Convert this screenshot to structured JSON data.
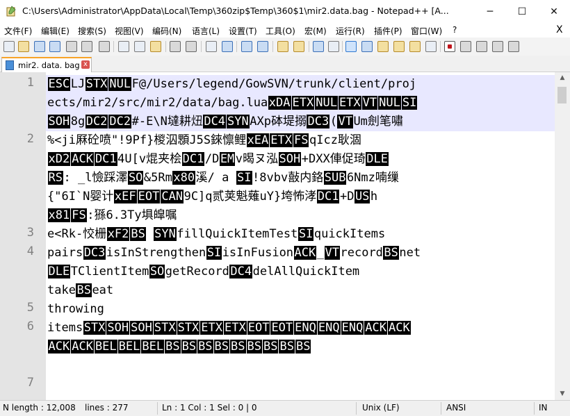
{
  "window": {
    "title": "C:\\Users\\Administrator\\AppData\\Local\\Temp\\360zip$Temp\\360$1\\mir2.data.bag - Notepad++ [A...",
    "minimize": "─",
    "maximize": "☐",
    "close": "✕"
  },
  "menu": {
    "items": [
      "文件(F)",
      "编辑(E)",
      "搜索(S)",
      "视图(V)",
      "编码(N)",
      "语言(L)",
      "设置(T)",
      "工具(O)",
      "宏(M)",
      "运行(R)",
      "插件(P)",
      "窗口(W)",
      "?"
    ],
    "close_doc": "X"
  },
  "tab": {
    "label": "mir2. data. bag",
    "close": "x"
  },
  "editor": {
    "line_numbers": [
      "1",
      "2",
      "3",
      "4",
      "5",
      "6",
      "7"
    ],
    "rows": [
      [
        {
          "c": "ESC"
        },
        {
          "t": "LJ"
        },
        {
          "c": "STX"
        },
        {
          "c": "NUL"
        },
        {
          "t": "F@/Users/legend/GowSVN/trunk/client/proj"
        }
      ],
      [
        {
          "t": "ects/mir2/src/mir2/data/bag.lua"
        },
        {
          "c": "xDA"
        },
        {
          "c": "ETX"
        },
        {
          "c": "NUL"
        },
        {
          "c": "ETX"
        },
        {
          "c": "VT"
        },
        {
          "c": "NUL"
        },
        {
          "c": "SI"
        }
      ],
      [
        {
          "c": "SOH"
        },
        {
          "t": "8g"
        },
        {
          "c": "DC2"
        },
        {
          "c": "DC2"
        },
        {
          "t": "#-E\\N墶耕炄"
        },
        {
          "c": "DC4"
        },
        {
          "c": "SYN"
        },
        {
          "t": "AXp砵堤搦"
        },
        {
          "c": "DC3"
        },
        {
          "t": "("
        },
        {
          "c": "VT"
        },
        {
          "t": "Um劍笔嘯"
        }
      ],
      [
        {
          "t": "%<ji厤砼喷\"!9Pf}椶泅顋J5S錸懔鲤"
        },
        {
          "c": "xEA"
        },
        {
          "c": "ETX"
        },
        {
          "c": "FS"
        },
        {
          "t": "qIcz耿涸"
        }
      ],
      [
        {
          "c": "xD2"
        },
        {
          "c": "ACK"
        },
        {
          "c": "DC1"
        },
        {
          "t": "4U[v焜夹桧"
        },
        {
          "c": "DC1"
        },
        {
          "t": "/D"
        },
        {
          "c": "EM"
        },
        {
          "t": "v暍ヌ泓"
        },
        {
          "c": "SOH"
        },
        {
          "t": "+DXX俥促琦"
        },
        {
          "c": "DLE"
        }
      ],
      [
        {
          "c": "RS"
        },
        {
          "t": ": _l憸踩澤"
        },
        {
          "c": "SO"
        },
        {
          "t": "&5Rm"
        },
        {
          "c": "x80"
        },
        {
          "t": "溪/ a "
        },
        {
          "c": "SI"
        },
        {
          "t": "!8vbv敼内鉻"
        },
        {
          "c": "SUB"
        },
        {
          "t": "6Nmz喃缫"
        }
      ],
      [
        {
          "t": "{\"6I`N婴计"
        },
        {
          "c": "xEF"
        },
        {
          "c": "EOT"
        },
        {
          "c": "CAN"
        },
        {
          "t": "9C]q贰荚魁薙uY}垮怖涍"
        },
        {
          "c": "DC1"
        },
        {
          "t": "+D"
        },
        {
          "c": "US"
        },
        {
          "t": "h"
        }
      ],
      [
        {
          "c": "x81"
        },
        {
          "c": "FS"
        },
        {
          "t": ":猻6.3Ty埧皡嘱"
        }
      ],
      [
        {
          "t": "e<Rk-恔栅"
        },
        {
          "c": "xF2"
        },
        {
          "c": "BS"
        },
        {
          "t": " "
        },
        {
          "c": "SYN"
        },
        {
          "t": "fillQuickItemTest"
        },
        {
          "c": "SI"
        },
        {
          "t": "quickItems"
        }
      ],
      [
        {
          "t": "pairs"
        },
        {
          "c": "DC3"
        },
        {
          "t": "isInStrengthen"
        },
        {
          "c": "SI"
        },
        {
          "t": "isInFusion"
        },
        {
          "c": "ACK"
        },
        {
          "t": "_"
        },
        {
          "c": "VT"
        },
        {
          "t": "record"
        },
        {
          "c": "BS"
        },
        {
          "t": "net"
        }
      ],
      [
        {
          "c": "DLE"
        },
        {
          "t": "TClientItem"
        },
        {
          "c": "SO"
        },
        {
          "t": "getRecord"
        },
        {
          "c": "DC4"
        },
        {
          "t": "delAllQuickItem"
        }
      ],
      [
        {
          "t": "take"
        },
        {
          "c": "BS"
        },
        {
          "t": "eat"
        }
      ],
      [
        {
          "t": "throwing"
        }
      ],
      [
        {
          "t": "items"
        },
        {
          "c": "STX"
        },
        {
          "c": "SOH"
        },
        {
          "c": "SOH"
        },
        {
          "c": "STX"
        },
        {
          "c": "STX"
        },
        {
          "c": "ETX"
        },
        {
          "c": "ETX"
        },
        {
          "c": "EOT"
        },
        {
          "c": "EOT"
        },
        {
          "c": "ENQ"
        },
        {
          "c": "ENQ"
        },
        {
          "c": "ENQ"
        },
        {
          "c": "ACK"
        },
        {
          "c": "ACK"
        }
      ],
      [
        {
          "c": "ACK"
        },
        {
          "c": "ACK"
        },
        {
          "c": "BEL"
        },
        {
          "c": "BEL"
        },
        {
          "c": "BEL"
        },
        {
          "c": "BS"
        },
        {
          "c": "BS"
        },
        {
          "c": "BS"
        },
        {
          "c": "BS"
        },
        {
          "c": "BS"
        },
        {
          "c": "BS"
        },
        {
          "c": "BS"
        },
        {
          "c": "BS"
        },
        {
          "c": "BS"
        }
      ]
    ]
  },
  "status": {
    "length": "N length : 12,008",
    "lines": "lines : 277",
    "position": "Ln : 1    Col : 1    Sel : 0 | 0",
    "eol": "Unix (LF)",
    "encoding": "ANSI",
    "mode": "IN"
  },
  "colors": {
    "current_line": "#e8e8ff",
    "gutter": "#e4e4e4",
    "control_char_bg": "#000000",
    "tab_accent": "#f8a327"
  }
}
